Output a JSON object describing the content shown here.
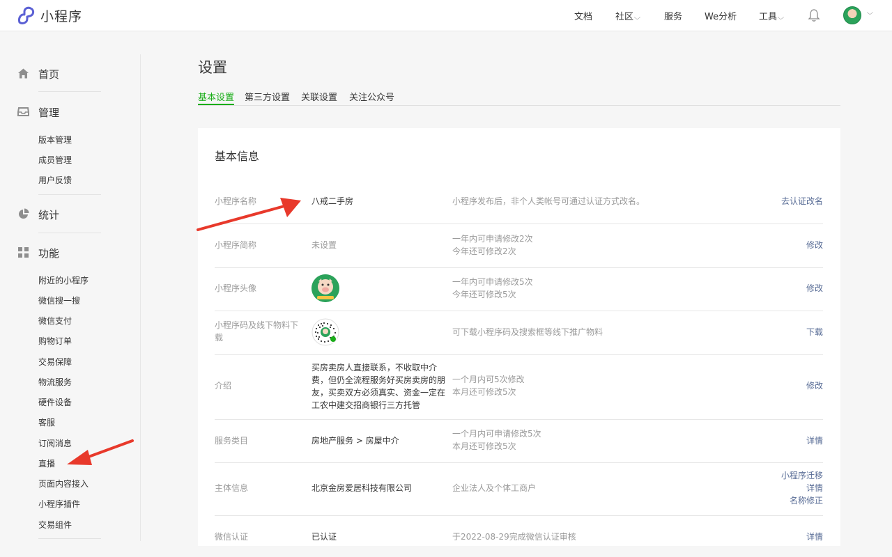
{
  "topbar": {
    "brand": "小程序",
    "nav": [
      {
        "label": "文档",
        "dropdown": false
      },
      {
        "label": "社区",
        "dropdown": true
      },
      {
        "label": "服务",
        "dropdown": false
      },
      {
        "label": "We分析",
        "dropdown": false
      },
      {
        "label": "工具",
        "dropdown": true
      }
    ],
    "chevron": "⌵"
  },
  "sidebar": {
    "groups": [
      {
        "title": "首页",
        "icon": "home-icon",
        "items": []
      },
      {
        "title": "管理",
        "icon": "inbox-icon",
        "items": [
          "版本管理",
          "成员管理",
          "用户反馈"
        ]
      },
      {
        "title": "统计",
        "icon": "pie-chart-icon",
        "items": []
      },
      {
        "title": "功能",
        "icon": "grid-icon",
        "items": [
          "附近的小程序",
          "微信搜一搜",
          "微信支付",
          "购物订单",
          "交易保障",
          "物流服务",
          "硬件设备",
          "客服",
          "订阅消息",
          "直播",
          "页面内容接入",
          "小程序插件",
          "交易组件"
        ]
      }
    ]
  },
  "page": {
    "title": "设置",
    "tabs": [
      "基本设置",
      "第三方设置",
      "关联设置",
      "关注公众号"
    ],
    "active_tab": 0
  },
  "basic_info": {
    "title": "基本信息",
    "rows": [
      {
        "label": "小程序名称",
        "value": "八戒二手房",
        "note": "小程序发布后，非个人类帐号可通过认证方式改名。",
        "actions": [
          "去认证改名"
        ]
      },
      {
        "label": "小程序简称",
        "value": "未设置",
        "note": "一年内可申请修改2次",
        "note2": "今年还可修改2次",
        "actions": [
          "修改"
        ]
      },
      {
        "label": "小程序头像",
        "value": "",
        "note": "一年内可申请修改5次",
        "note2": "今年还可修改5次",
        "actions": [
          "修改"
        ]
      },
      {
        "label": "小程序码及线下物料下",
        "label2": "载",
        "value": "",
        "note": "可下载小程序码及搜索框等线下推广物料",
        "actions": [
          "下载"
        ]
      },
      {
        "label": "介绍",
        "value_lines": [
          "买房卖房人直接联系，不收取中介",
          "费，但仍全流程服务好买房卖房的朋",
          "友，买卖双方必须真实、资金一定在",
          "工农中建交招商银行三方托管"
        ],
        "note": "一个月内可5次修改",
        "note2": "本月还可修改5次",
        "actions": [
          "修改"
        ]
      },
      {
        "label": "服务类目",
        "value": "房地产服务 > 房屋中介",
        "note": "一个月内可申请修改5次",
        "note2": "本月还可修改5次",
        "actions": [
          "详情"
        ]
      },
      {
        "label": "主体信息",
        "value": "北京金房爱居科技有限公司",
        "note": "企业法人及个体工商户",
        "actions": [
          "小程序迁移",
          "详情",
          "名称修正"
        ]
      },
      {
        "label": "微信认证",
        "value": "已认证",
        "note": "于2022-08-29完成微信认证审核",
        "actions": [
          "详情"
        ]
      }
    ]
  },
  "colors": {
    "accent": "#1aad19",
    "link": "#576b95",
    "arrow": "#e8392b"
  }
}
